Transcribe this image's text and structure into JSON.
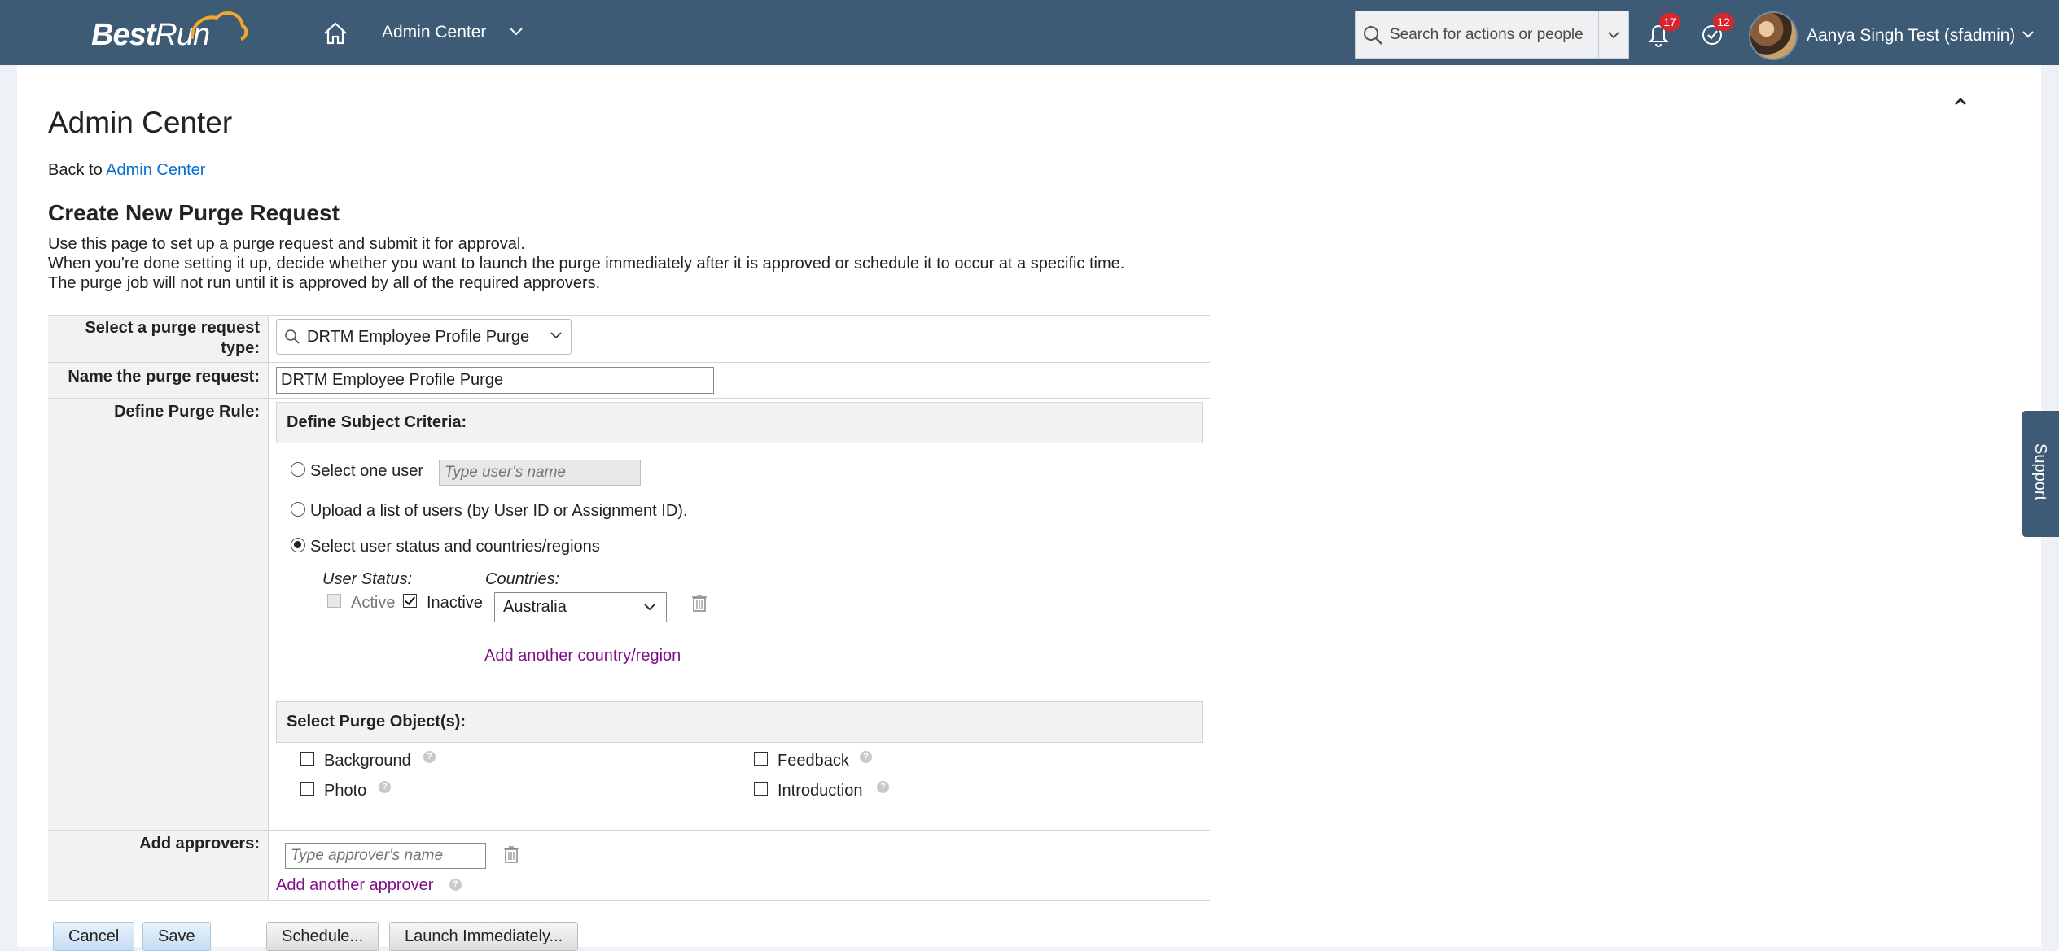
{
  "shell": {
    "logo_text_a": "Best",
    "logo_text_b": "Run",
    "module_title": "Admin Center",
    "search_placeholder": "Search for actions or people",
    "notifications_count": "17",
    "todo_count": "12",
    "user_name": "Aanya Singh Test (sfadmin)",
    "accent": "#3d5b74"
  },
  "page": {
    "title": "Admin Center",
    "back_prefix": "Back to",
    "back_link": "Admin Center",
    "section_title": "Create New Purge Request",
    "intro_lines": [
      "Use this page to set up a purge request and submit it for approval.",
      "When you're done setting it up, decide whether you want to launch the purge immediately after it is approved or schedule it to occur at a specific time.",
      "The purge job will not run until it is approved by all of the required approvers."
    ]
  },
  "form": {
    "purge_type_label": "Select a purge request type:",
    "purge_type_value": "DRTM Employee Profile Purge",
    "name_label": "Name the purge request:",
    "name_value": "DRTM Employee Profile Purge",
    "rule_label": "Define Purge Rule:",
    "subject_header": "Define Subject Criteria:",
    "option_one_user": "Select one user",
    "user_placeholder": "Type user's name",
    "option_upload": "Upload a list of users (by User ID or Assignment ID).",
    "option_status": "Select user status and countries/regions",
    "user_status_label": "User Status:",
    "countries_label": "Countries:",
    "status_active": "Active",
    "status_inactive": "Inactive",
    "country_value": "Australia",
    "add_country": "Add another country/region",
    "objects_header": "Select Purge Object(s):",
    "objects": [
      "Background",
      "Feedback",
      "Photo",
      "Introduction"
    ],
    "approvers_label": "Add approvers:",
    "approver_placeholder": "Type approver's name",
    "add_approver": "Add another approver"
  },
  "buttons": {
    "cancel": "Cancel",
    "save": "Save",
    "schedule": "Schedule...",
    "launch": "Launch Immediately..."
  },
  "support": "Support"
}
